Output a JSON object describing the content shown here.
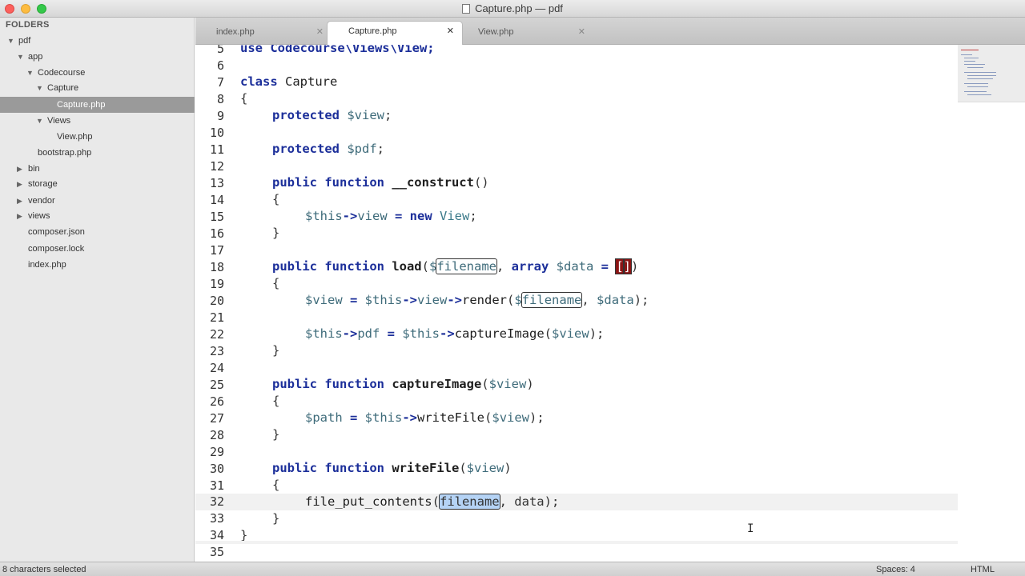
{
  "window": {
    "title": "Capture.php — pdf"
  },
  "sidebar": {
    "header": "FOLDERS",
    "items": [
      {
        "label": "pdf",
        "arrow": "▼"
      },
      {
        "label": "app",
        "arrow": "▼"
      },
      {
        "label": "Codecourse",
        "arrow": "▼"
      },
      {
        "label": "Capture",
        "arrow": "▼"
      },
      {
        "label": "Capture.php",
        "arrow": ""
      },
      {
        "label": "Views",
        "arrow": "▼"
      },
      {
        "label": "View.php",
        "arrow": ""
      },
      {
        "label": "bootstrap.php",
        "arrow": ""
      },
      {
        "label": "bin",
        "arrow": "▶"
      },
      {
        "label": "storage",
        "arrow": "▶"
      },
      {
        "label": "vendor",
        "arrow": "▶"
      },
      {
        "label": "views",
        "arrow": "▶"
      },
      {
        "label": "composer.json",
        "arrow": ""
      },
      {
        "label": "composer.lock",
        "arrow": ""
      },
      {
        "label": "index.php",
        "arrow": ""
      }
    ]
  },
  "tabs": [
    {
      "label": "index.php",
      "close": "✕"
    },
    {
      "label": "Capture.php",
      "close": "✕"
    },
    {
      "label": "View.php",
      "close": "✕"
    }
  ],
  "editor": {
    "line_numbers": [
      "5",
      "6",
      "7",
      "8",
      "9",
      "10",
      "11",
      "12",
      "13",
      "14",
      "15",
      "16",
      "17",
      "18",
      "19",
      "20",
      "21",
      "22",
      "23",
      "24",
      "25",
      "26",
      "27",
      "28",
      "29",
      "30",
      "31",
      "32",
      "33",
      "34",
      "35"
    ],
    "code": {
      "l5_a": "use ",
      "l5_b": "Codecourse\\Views\\View;",
      "l7_a": "class ",
      "l7_b": "Capture",
      "l8": "{",
      "l9_a": "protected ",
      "l9_b": "$view",
      "l9_c": ";",
      "l11_a": "protected ",
      "l11_b": "$pdf",
      "l11_c": ";",
      "l13_a": "public function ",
      "l13_b": "__construct",
      "l13_c": "()",
      "l14": "{",
      "l15_a": "$this",
      "l15_b": "->",
      "l15_c": "view",
      "l15_d": " = ",
      "l15_e": "new ",
      "l15_f": "View",
      "l15_g": ";",
      "l16": "}",
      "l18_a": "public function ",
      "l18_b": "load",
      "l18_c": "(",
      "l18_d": "$",
      "l18_e": "filename",
      "l18_f": ", ",
      "l18_g": "array ",
      "l18_h": "$data",
      "l18_i": " = ",
      "l18_j": "[",
      "l18_k": "]",
      "l18_l": ")",
      "l19": "{",
      "l20_a": "$view",
      "l20_b": " = ",
      "l20_c": "$this",
      "l20_d": "->",
      "l20_e": "view",
      "l20_f": "->",
      "l20_g": "render",
      "l20_h": "(",
      "l20_i": "$",
      "l20_j": "filename",
      "l20_k": ", ",
      "l20_l": "$data",
      "l20_m": ");",
      "l22_a": "$this",
      "l22_b": "->",
      "l22_c": "pdf",
      "l22_d": " = ",
      "l22_e": "$this",
      "l22_f": "->",
      "l22_g": "captureImage",
      "l22_h": "(",
      "l22_i": "$view",
      "l22_j": ");",
      "l23": "}",
      "l25_a": "public function ",
      "l25_b": "captureImage",
      "l25_c": "(",
      "l25_d": "$view",
      "l25_e": ")",
      "l26": "{",
      "l27_a": "$path",
      "l27_b": " = ",
      "l27_c": "$this",
      "l27_d": "->",
      "l27_e": "writeFile",
      "l27_f": "(",
      "l27_g": "$view",
      "l27_h": ");",
      "l28": "}",
      "l30_a": "public function ",
      "l30_b": "writeFile",
      "l30_c": "(",
      "l30_d": "$view",
      "l30_e": ")",
      "l31": "{",
      "l32_a": "file_put_contents",
      "l32_b": "(",
      "l32_c": "filename",
      "l32_d": ", data);",
      "l33": "}",
      "l34": "}"
    },
    "mouse_cursor": "I"
  },
  "status": {
    "selection": "8 characters selected",
    "spaces": "Spaces: 4",
    "syntax": "HTML"
  },
  "colors": {
    "keyword": "#1c2f9a",
    "variable": "#3e6b7a",
    "class_name": "#3b7a8a",
    "selected_sidebar": "#9a9a9a"
  }
}
